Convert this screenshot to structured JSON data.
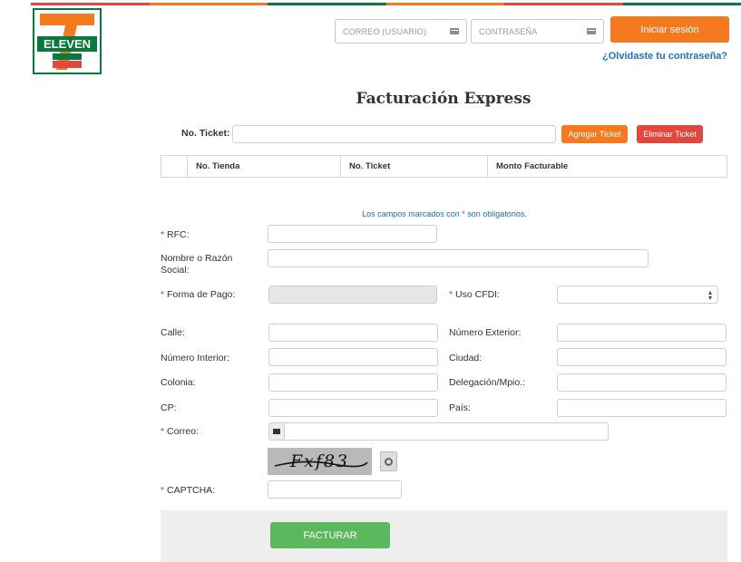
{
  "colors": {
    "brand_orange": "#f57a1f",
    "brand_green": "#0a7a3c",
    "brand_red": "#e0483e",
    "link_blue": "#1a73c9",
    "success_green": "#5cb85c"
  },
  "logo": {
    "text": "ELEVEN",
    "number": "7"
  },
  "login": {
    "email_placeholder": "CORREO (USUARIO)",
    "password_placeholder": "CONTRASEÑA",
    "login_button": "Iniciar sesión",
    "forgot_link": "¿Olvidaste tu contraseña?"
  },
  "page": {
    "title": "Facturación Express"
  },
  "ticket": {
    "label": "No. Ticket:",
    "add_button": "Agregar Ticket",
    "delete_button": "Eliminar Ticket",
    "table_headers": [
      "",
      "No. Tienda",
      "No. Ticket",
      "Monto Facturable"
    ]
  },
  "form": {
    "required_marker": "*",
    "notice_prefix": "Los campos marcados con",
    "notice_suffix": "son obligatorios.",
    "rfc": "RFC:",
    "nombre_line1": "Nombre o Razón",
    "nombre_line2": "Social:",
    "forma_pago": "Forma de Pago:",
    "uso_cfdi": "Uso CFDI:",
    "calle": "Calle:",
    "numero_exterior": "Número Exterior:",
    "numero_interior": "Número Interior:",
    "ciudad": "Ciudad:",
    "colonia": "Colonia:",
    "delegacion": "Delegación/Mpio.:",
    "cp": "CP:",
    "pais": "País:",
    "correo": "Correo:",
    "captcha": "CAPTCHA:",
    "captcha_value": "Fxf83",
    "submit_button": "FACTURAR"
  }
}
